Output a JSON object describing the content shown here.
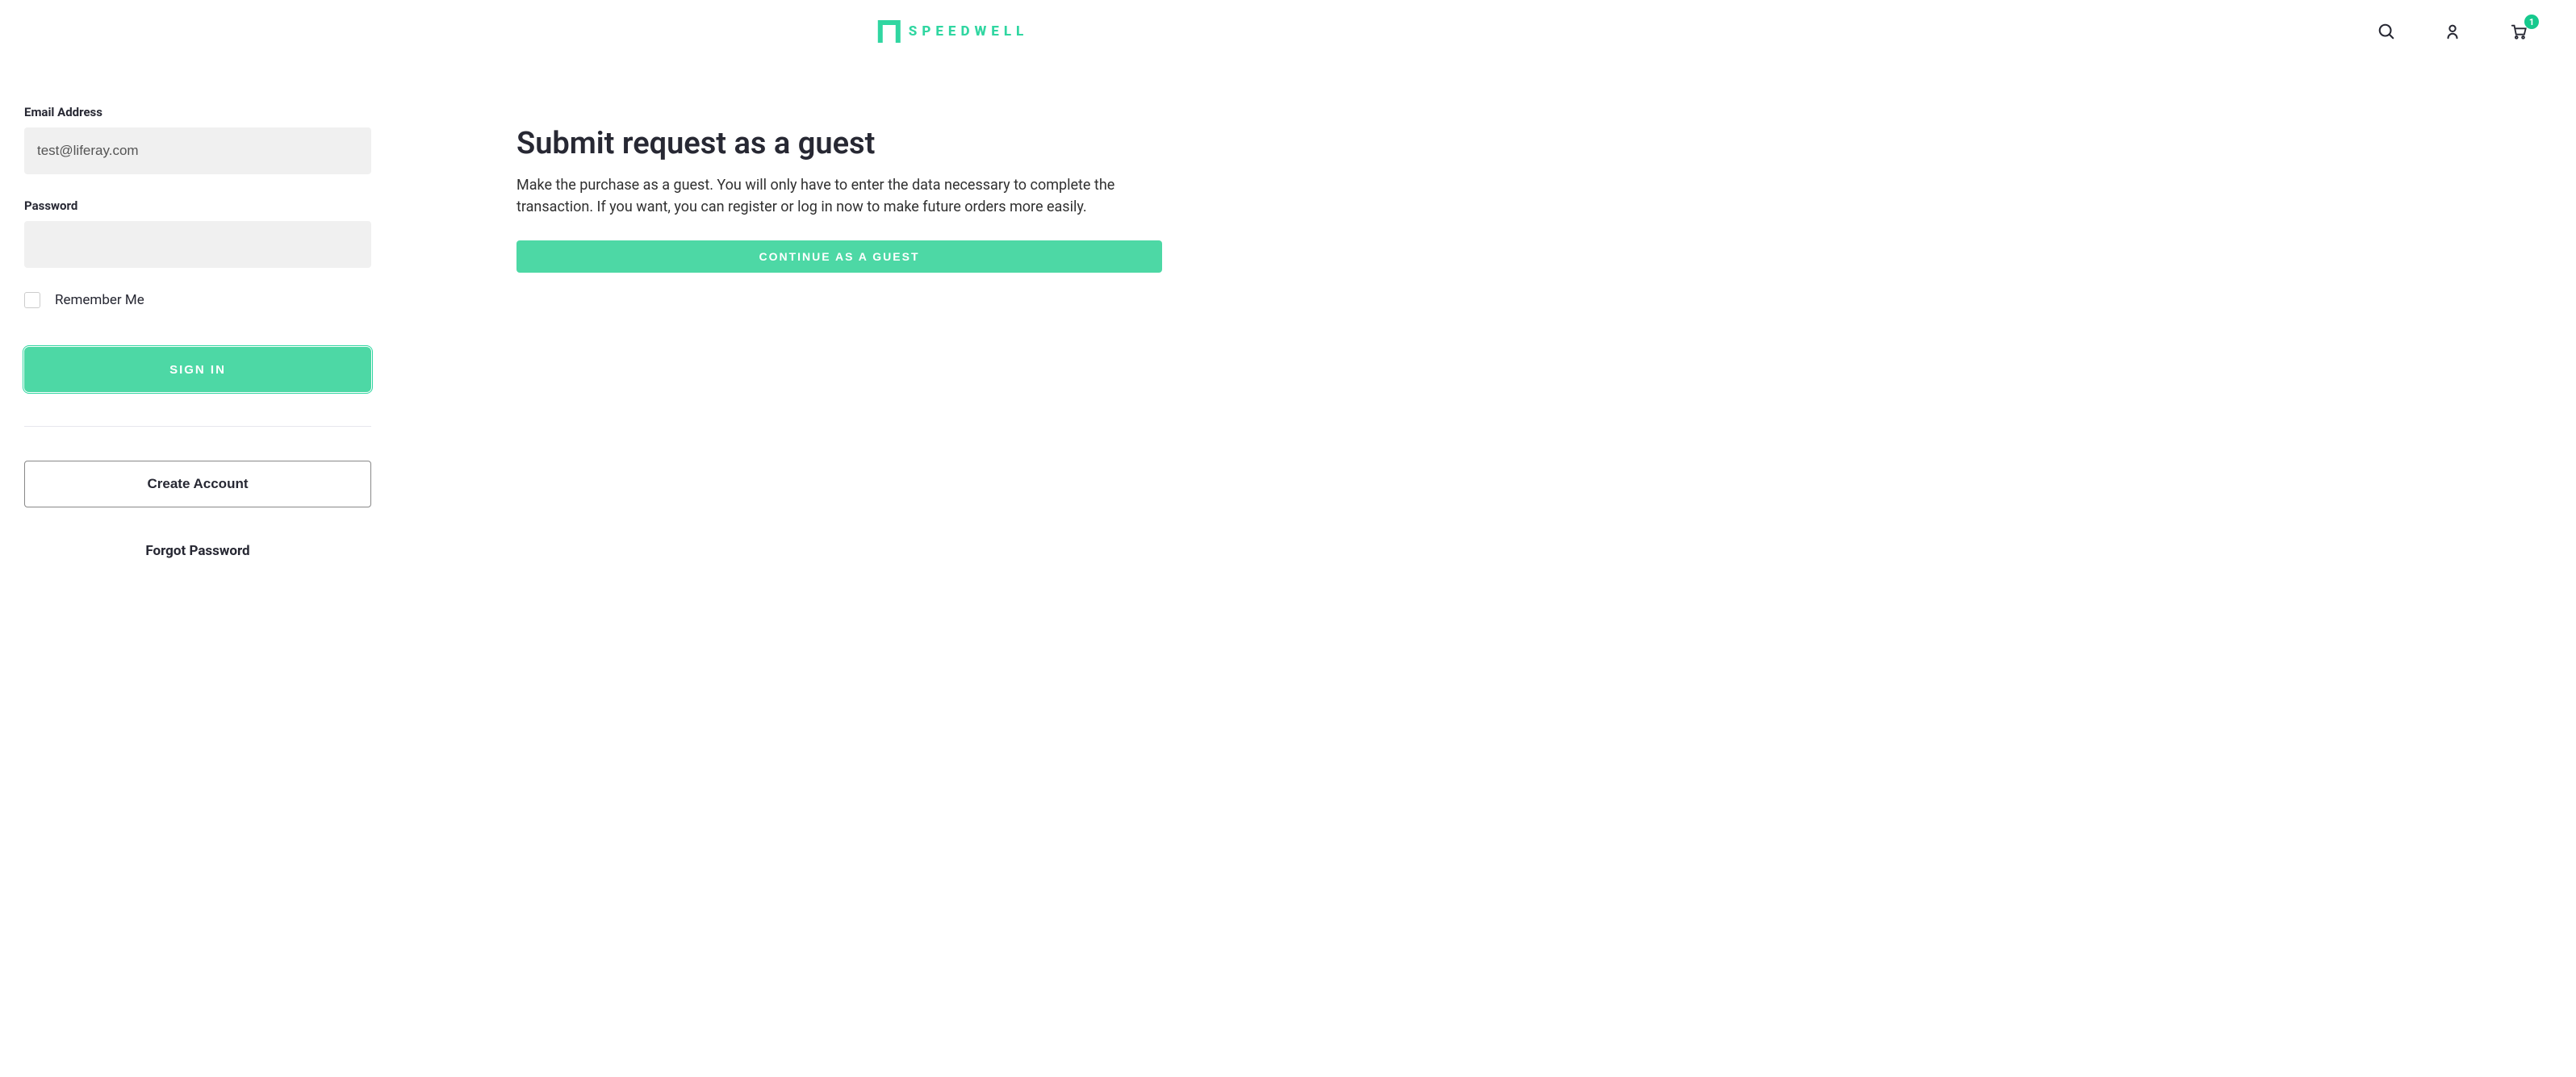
{
  "header": {
    "brand_text": "SPEEDWELL",
    "cart_count": "1"
  },
  "signin": {
    "email_label": "Email Address",
    "email_value": "test@liferay.com",
    "password_label": "Password",
    "remember_label": "Remember Me",
    "submit_label": "SIGN IN",
    "create_label": "Create Account",
    "forgot_label": "Forgot Password"
  },
  "guest": {
    "title": "Submit request as a guest",
    "description": "Make the purchase as a guest. You will only have to enter the data necessary to complete the transaction. If you want, you can register or log in now to make future orders more easily.",
    "cta_label": "CONTINUE AS A GUEST"
  }
}
